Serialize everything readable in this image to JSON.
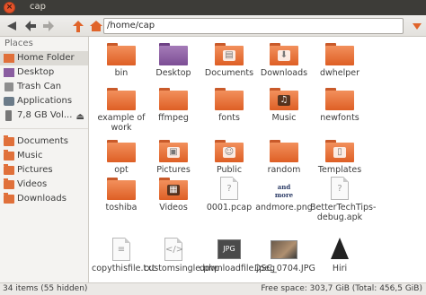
{
  "window": {
    "title": "cap"
  },
  "toolbar": {
    "path": "/home/cap"
  },
  "sidebar": {
    "heading": "Places",
    "places": [
      {
        "label": "Home Folder",
        "icon": "home-folder-icon"
      },
      {
        "label": "Desktop",
        "icon": "desktop-folder-icon"
      },
      {
        "label": "Trash Can",
        "icon": "trash-icon"
      },
      {
        "label": "Applications",
        "icon": "applications-icon"
      },
      {
        "label": "7,8 GB Vol...",
        "icon": "drive-icon"
      }
    ],
    "bookmarks": [
      {
        "label": "Documents"
      },
      {
        "label": "Music"
      },
      {
        "label": "Pictures"
      },
      {
        "label": "Videos"
      },
      {
        "label": "Downloads"
      }
    ]
  },
  "files": [
    {
      "name": "bin",
      "kind": "folder"
    },
    {
      "name": "Desktop",
      "kind": "folder-purple"
    },
    {
      "name": "Documents",
      "kind": "folder",
      "emblem": "documents-icon"
    },
    {
      "name": "Downloads",
      "kind": "folder",
      "emblem": "download-icon"
    },
    {
      "name": "dwhelper",
      "kind": "folder"
    },
    {
      "name": "example of work",
      "kind": "folder"
    },
    {
      "name": "ffmpeg",
      "kind": "folder"
    },
    {
      "name": "fonts",
      "kind": "folder"
    },
    {
      "name": "Music",
      "kind": "folder",
      "emblem": "music-icon"
    },
    {
      "name": "newfonts",
      "kind": "folder"
    },
    {
      "name": "opt",
      "kind": "folder"
    },
    {
      "name": "Pictures",
      "kind": "folder",
      "emblem": "pictures-icon"
    },
    {
      "name": "Public",
      "kind": "folder",
      "emblem": "public-icon"
    },
    {
      "name": "random",
      "kind": "folder"
    },
    {
      "name": "Templates",
      "kind": "folder",
      "emblem": "templates-icon"
    },
    {
      "name": "toshiba",
      "kind": "folder"
    },
    {
      "name": "Videos",
      "kind": "folder",
      "emblem": "film-icon"
    },
    {
      "name": "0001.pcap",
      "kind": "unknown"
    },
    {
      "name": "andmore.png",
      "kind": "image-text",
      "thumb": "and more"
    },
    {
      "name": "BetterTechTips-debug.apk",
      "kind": "unknown"
    },
    {
      "name": "copythisfile.txt",
      "kind": "text"
    },
    {
      "name": "customsingle.php",
      "kind": "php"
    },
    {
      "name": "downloadfile.jpeg",
      "kind": "jpg",
      "thumb": "JPG"
    },
    {
      "name": "DSC_0704.JPG",
      "kind": "photo"
    },
    {
      "name": "Hiri",
      "kind": "inkscape"
    }
  ],
  "status": {
    "selection": "34 items (55 hidden)",
    "space": "Free space: 303,7 GiB (Total: 456,5 GiB)"
  },
  "colors": {
    "folder": "#e0642a",
    "desktop_folder": "#8a5da0",
    "titlebar": "#3d3c38",
    "close_button": "#e6532a"
  }
}
